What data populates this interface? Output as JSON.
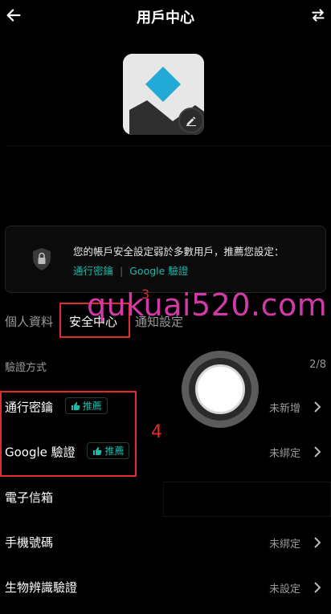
{
  "header": {
    "title": "用戶中心",
    "back_icon": "back-arrow-icon",
    "switch_icon": "swap-icon"
  },
  "avatar": {
    "edit_icon": "pencil-icon"
  },
  "notice": {
    "message": "您的帳戶安全設定弱於多數用戶，推薦您設定：",
    "link_1": "通行密鑰",
    "separator": "|",
    "link_2": "Google 驗證",
    "icon": "shield-lock-icon"
  },
  "tabs": [
    {
      "label": "個人資料"
    },
    {
      "label": "安全中心"
    },
    {
      "label": "通知設定"
    }
  ],
  "annotations": {
    "num_3": "3",
    "num_4": "4",
    "watermark": "qukuai520.com"
  },
  "section": {
    "label": "驗證方式",
    "count": "2/8"
  },
  "rows": [
    {
      "label": "通行密鑰",
      "badge": "推薦",
      "value": "未新增"
    },
    {
      "label": "Google 驗證",
      "badge": "推薦",
      "value": "未綁定"
    },
    {
      "label": "電子信箱",
      "value": ""
    },
    {
      "label": "手機號碼",
      "value": "未綁定"
    },
    {
      "label": "生物辨識驗證",
      "value": "未設定"
    }
  ],
  "colors": {
    "accent": "#1fb9a8",
    "annotation_red": "#e22b2b",
    "watermark": "#d23aa7",
    "background": "#000000"
  }
}
